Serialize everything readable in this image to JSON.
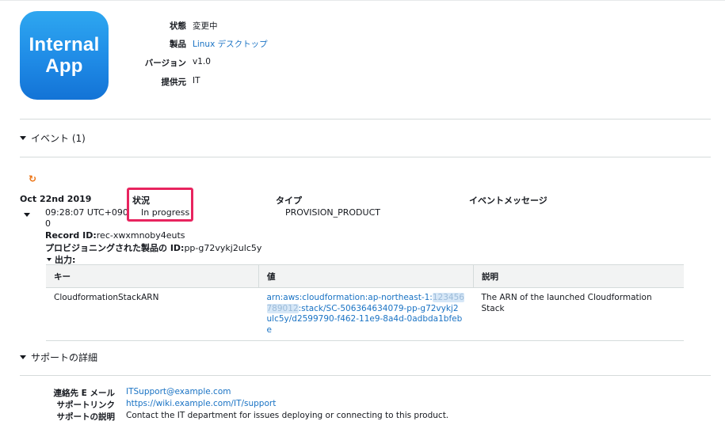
{
  "app_icon": {
    "line1": "Internal",
    "line2": "App",
    "color": "#1f8be6"
  },
  "product_info": [
    {
      "label": "状態",
      "value": "変更中",
      "is_link": false
    },
    {
      "label": "製品",
      "value": "Linux デスクトップ",
      "is_link": true
    },
    {
      "label": "バージョン",
      "value": "v1.0",
      "is_link": false
    },
    {
      "label": "提供元",
      "value": "IT",
      "is_link": false
    }
  ],
  "events_section": {
    "title": "イベント (1)"
  },
  "events_header": {
    "date": "Oct 22nd 2019",
    "status": "状況",
    "type": "タイプ",
    "message": "イベントメッセージ"
  },
  "event": {
    "time_line1": "09:28:07 UTC+090",
    "time_line2": "0",
    "status": "In progress",
    "type": "PROVISION_PRODUCT",
    "record_id_label": "Record ID:",
    "record_id": "rec-xwxmnoby4euts",
    "provisioned_label": "プロビジョニングされた製品の ID:",
    "provisioned_id": "pp-g72vykj2ulc5y",
    "outputs_label": "出力:"
  },
  "outputs_table": {
    "headers": [
      "キー",
      "値",
      "説明"
    ],
    "row": {
      "key": "CloudformationStackARN",
      "value_line1": "arn:aws:cloudformation:ap-northeast-1:",
      "value_redact1": "123456",
      "value_redact2": "789012",
      "value_line2": ":stack/SC-506364634079-pp-g72vykj2",
      "value_line3": "ulc5y/d2599790-f462-11e9-8a4d-0adbda1bfeb",
      "value_line4": "e",
      "description": "The ARN of the launched Cloudformation Stack"
    }
  },
  "support_section": {
    "title": "サポートの詳細"
  },
  "support": [
    {
      "label": "連絡先 E メール",
      "value": "ITSupport@example.com",
      "is_link": true
    },
    {
      "label": "サポートリンク",
      "value": "https://wiki.example.com/IT/support",
      "is_link": true
    },
    {
      "label": "サポートの説明",
      "value": "Contact the IT department for issues deploying or connecting to this product.",
      "is_link": false
    }
  ],
  "colors": {
    "highlight": "#e8245f",
    "link": "#1a73c4",
    "refresh": "#ec7211"
  }
}
